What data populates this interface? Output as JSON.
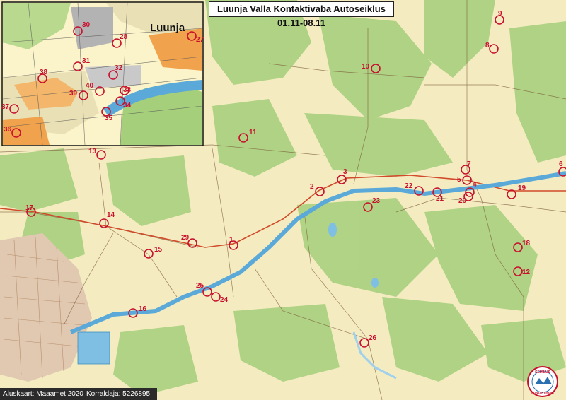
{
  "title": "Luunja Valla Kontaktivaba Autoseiklus 01.11-08.11",
  "inset": {
    "place_name": "Luunja"
  },
  "footer": {
    "basemap": "Aluskaart: Maaamet 2020",
    "organizer": "Korraldaja: 5226895"
  },
  "badge": {
    "text_top": "SEIKLUS",
    "text_bottom": "KONTAKTIVABA"
  },
  "colors": {
    "marker": "#c8102e",
    "river": "#5aa9d8",
    "forest": "#a5cf7a",
    "field": "#f4ecc0"
  },
  "markers_main": [
    {
      "label": "1"
    },
    {
      "label": "2"
    },
    {
      "label": "3"
    },
    {
      "label": "4"
    },
    {
      "label": "5"
    },
    {
      "label": "6"
    },
    {
      "label": "7"
    },
    {
      "label": "8"
    },
    {
      "label": "9"
    },
    {
      "label": "10"
    },
    {
      "label": "11"
    },
    {
      "label": "12"
    },
    {
      "label": "13"
    },
    {
      "label": "14"
    },
    {
      "label": "15"
    },
    {
      "label": "16"
    },
    {
      "label": "17"
    },
    {
      "label": "18"
    },
    {
      "label": "19"
    },
    {
      "label": "20"
    },
    {
      "label": "21"
    },
    {
      "label": "22"
    },
    {
      "label": "23"
    },
    {
      "label": "24"
    },
    {
      "label": "25"
    },
    {
      "label": "26"
    },
    {
      "label": "29"
    }
  ],
  "markers_inset": [
    {
      "label": "27"
    },
    {
      "label": "28"
    },
    {
      "label": "30"
    },
    {
      "label": "31"
    },
    {
      "label": "32"
    },
    {
      "label": "33"
    },
    {
      "label": "34"
    },
    {
      "label": "35"
    },
    {
      "label": "36"
    },
    {
      "label": "37"
    },
    {
      "label": "38"
    },
    {
      "label": "39"
    },
    {
      "label": "40"
    }
  ]
}
